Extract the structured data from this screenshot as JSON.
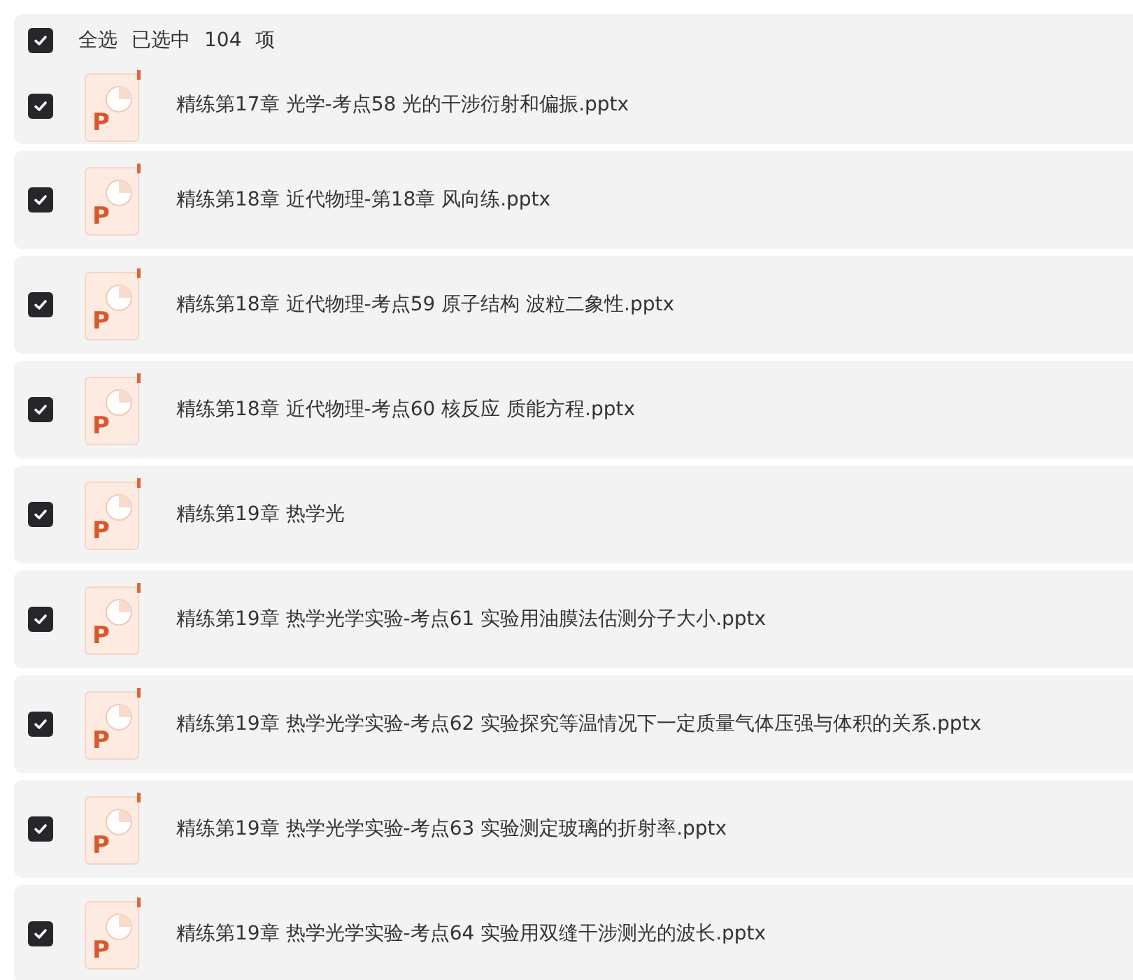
{
  "select_all": {
    "checked": true,
    "label": "全选",
    "selected_text": "已选中",
    "count": "104",
    "unit": "项"
  },
  "files": [
    {
      "name": "精练第17章 光学-考点58 光的干涉衍射和偏振.pptx",
      "checked": true,
      "icon_label": "P"
    },
    {
      "name": "精练第18章 近代物理-第18章 风向练.pptx",
      "checked": true,
      "icon_label": "P"
    },
    {
      "name": "精练第18章 近代物理-考点59 原子结构 波粒二象性.pptx",
      "checked": true,
      "icon_label": "P"
    },
    {
      "name": "精练第18章 近代物理-考点60 核反应 质能方程.pptx",
      "checked": true,
      "icon_label": "P"
    },
    {
      "name": "精练第19章 热学光",
      "checked": true,
      "icon_label": "P"
    },
    {
      "name": "精练第19章 热学光学实验-考点61 实验用油膜法估测分子大小.pptx",
      "checked": true,
      "icon_label": "P"
    },
    {
      "name": "精练第19章 热学光学实验-考点62 实验探究等温情况下一定质量气体压强与体积的关系.pptx",
      "checked": true,
      "icon_label": "P"
    },
    {
      "name": "精练第19章 热学光学实验-考点63 实验测定玻璃的折射率.pptx",
      "checked": true,
      "icon_label": "P"
    },
    {
      "name": "精练第19章 热学光学实验-考点64 实验用双缝干涉测光的波长.pptx",
      "checked": true,
      "icon_label": "P"
    }
  ]
}
